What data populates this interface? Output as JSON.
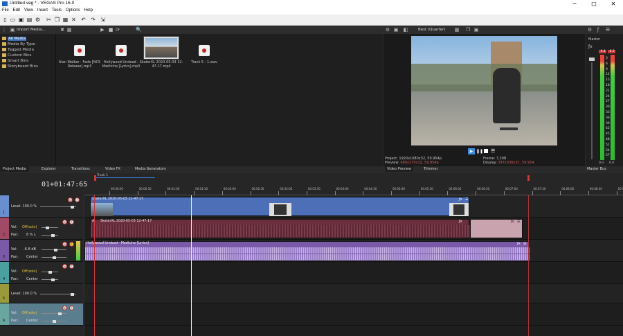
{
  "window": {
    "title": "Untitled.veg * - VEGAS Pro 16.0",
    "minimize": "─",
    "maximize": "□",
    "close": "✕"
  },
  "menu": [
    "File",
    "Edit",
    "View",
    "Insert",
    "Tools",
    "Options",
    "Help"
  ],
  "media_panel": {
    "toolbar_label": "Import Media...",
    "tree": [
      "All Media",
      "Media By Type",
      "Tagged Media",
      "Custom Bins",
      "Smart Bins",
      "Storyboard Bins"
    ],
    "items": [
      {
        "name": "Alan Walker - Fade [NCS Release].mp3"
      },
      {
        "name": "Hollywood Undead - Medicine [Lyrics].mp3"
      },
      {
        "name": "SkaterXL 2020-05-03 12-47-17.mp4"
      },
      {
        "name": "Track 5 - 1.wav"
      }
    ]
  },
  "left_tabs": [
    "Project Media",
    "Explorer",
    "Transitions",
    "Video FX",
    "Media Generators"
  ],
  "preview": {
    "quality": "Best (Quarter)",
    "project_label": "Project:",
    "project_value": "1920x1080x32, 59.954p",
    "preview_label": "Preview:",
    "preview_value": "480x270x32, 59.954p",
    "frame_label": "Frame:",
    "frame_value": "7,208",
    "display_label": "Display:",
    "display_value": "397x336x32, 59.954",
    "tabs": [
      "Video Preview",
      "Trimmer"
    ]
  },
  "master": {
    "title": "Master",
    "tab": "Master Bus",
    "peak_left": "-6.4",
    "peak_right": "-6.5",
    "scale": [
      "3",
      "6",
      "9",
      "12",
      "15",
      "18",
      "21",
      "24",
      "27",
      "30",
      "33",
      "36",
      "39",
      "42",
      "45",
      "48",
      "51",
      "54",
      "57"
    ],
    "bottom_left": "0.0",
    "bottom_right": "0.0"
  },
  "timeline": {
    "timecode": "01+01:47:65",
    "marker": "Track 1",
    "ruler": [
      "00:00:00",
      "00:00:30",
      "00:01:00",
      "00:01:30",
      "00:02:00",
      "00:02:30",
      "00:03:00",
      "00:03:30",
      "00:04:00",
      "00:04:30",
      "00:05:00",
      "00:05:30",
      "00:06:00",
      "00:06:30",
      "00:07:00",
      "00:07:30",
      "00:08:00",
      "00:08:30",
      "00:09:00"
    ],
    "tracks": [
      {
        "num": "1",
        "level": "Level: 100.0 %",
        "color": "#6a8fd0"
      },
      {
        "num": "2",
        "vol_label": "Vol:",
        "vol": "Off(solo)",
        "pan_label": "Pan:",
        "pan": "8 % L",
        "color": "#a04a66"
      },
      {
        "num": "3",
        "vol_label": "Vol:",
        "vol": "-6.8 dB",
        "pan_label": "Pan:",
        "pan": "Center",
        "color": "#7a5aa8"
      },
      {
        "num": "4",
        "vol_label": "Vol:",
        "vol": "Off(solo)",
        "pan_label": "Pan:",
        "pan": "Center",
        "color": "#4aa0a0"
      },
      {
        "num": "5",
        "level": "Level: 100.0 %",
        "color": "#9a9a3a"
      },
      {
        "num": "6",
        "vol_label": "Vol:",
        "vol": "Off(solo)",
        "pan_label": "Pan:",
        "pan": "Center",
        "color": "#6aa6a0"
      }
    ],
    "clips": {
      "video": "SkaterXL 2020-05-03 12-47-17",
      "audio1": "SkaterXL 2020-05-03 12-47-17",
      "audio1_short": "A.",
      "audio2": "Hollywood Undead - Medicine [Lyrics]"
    }
  }
}
